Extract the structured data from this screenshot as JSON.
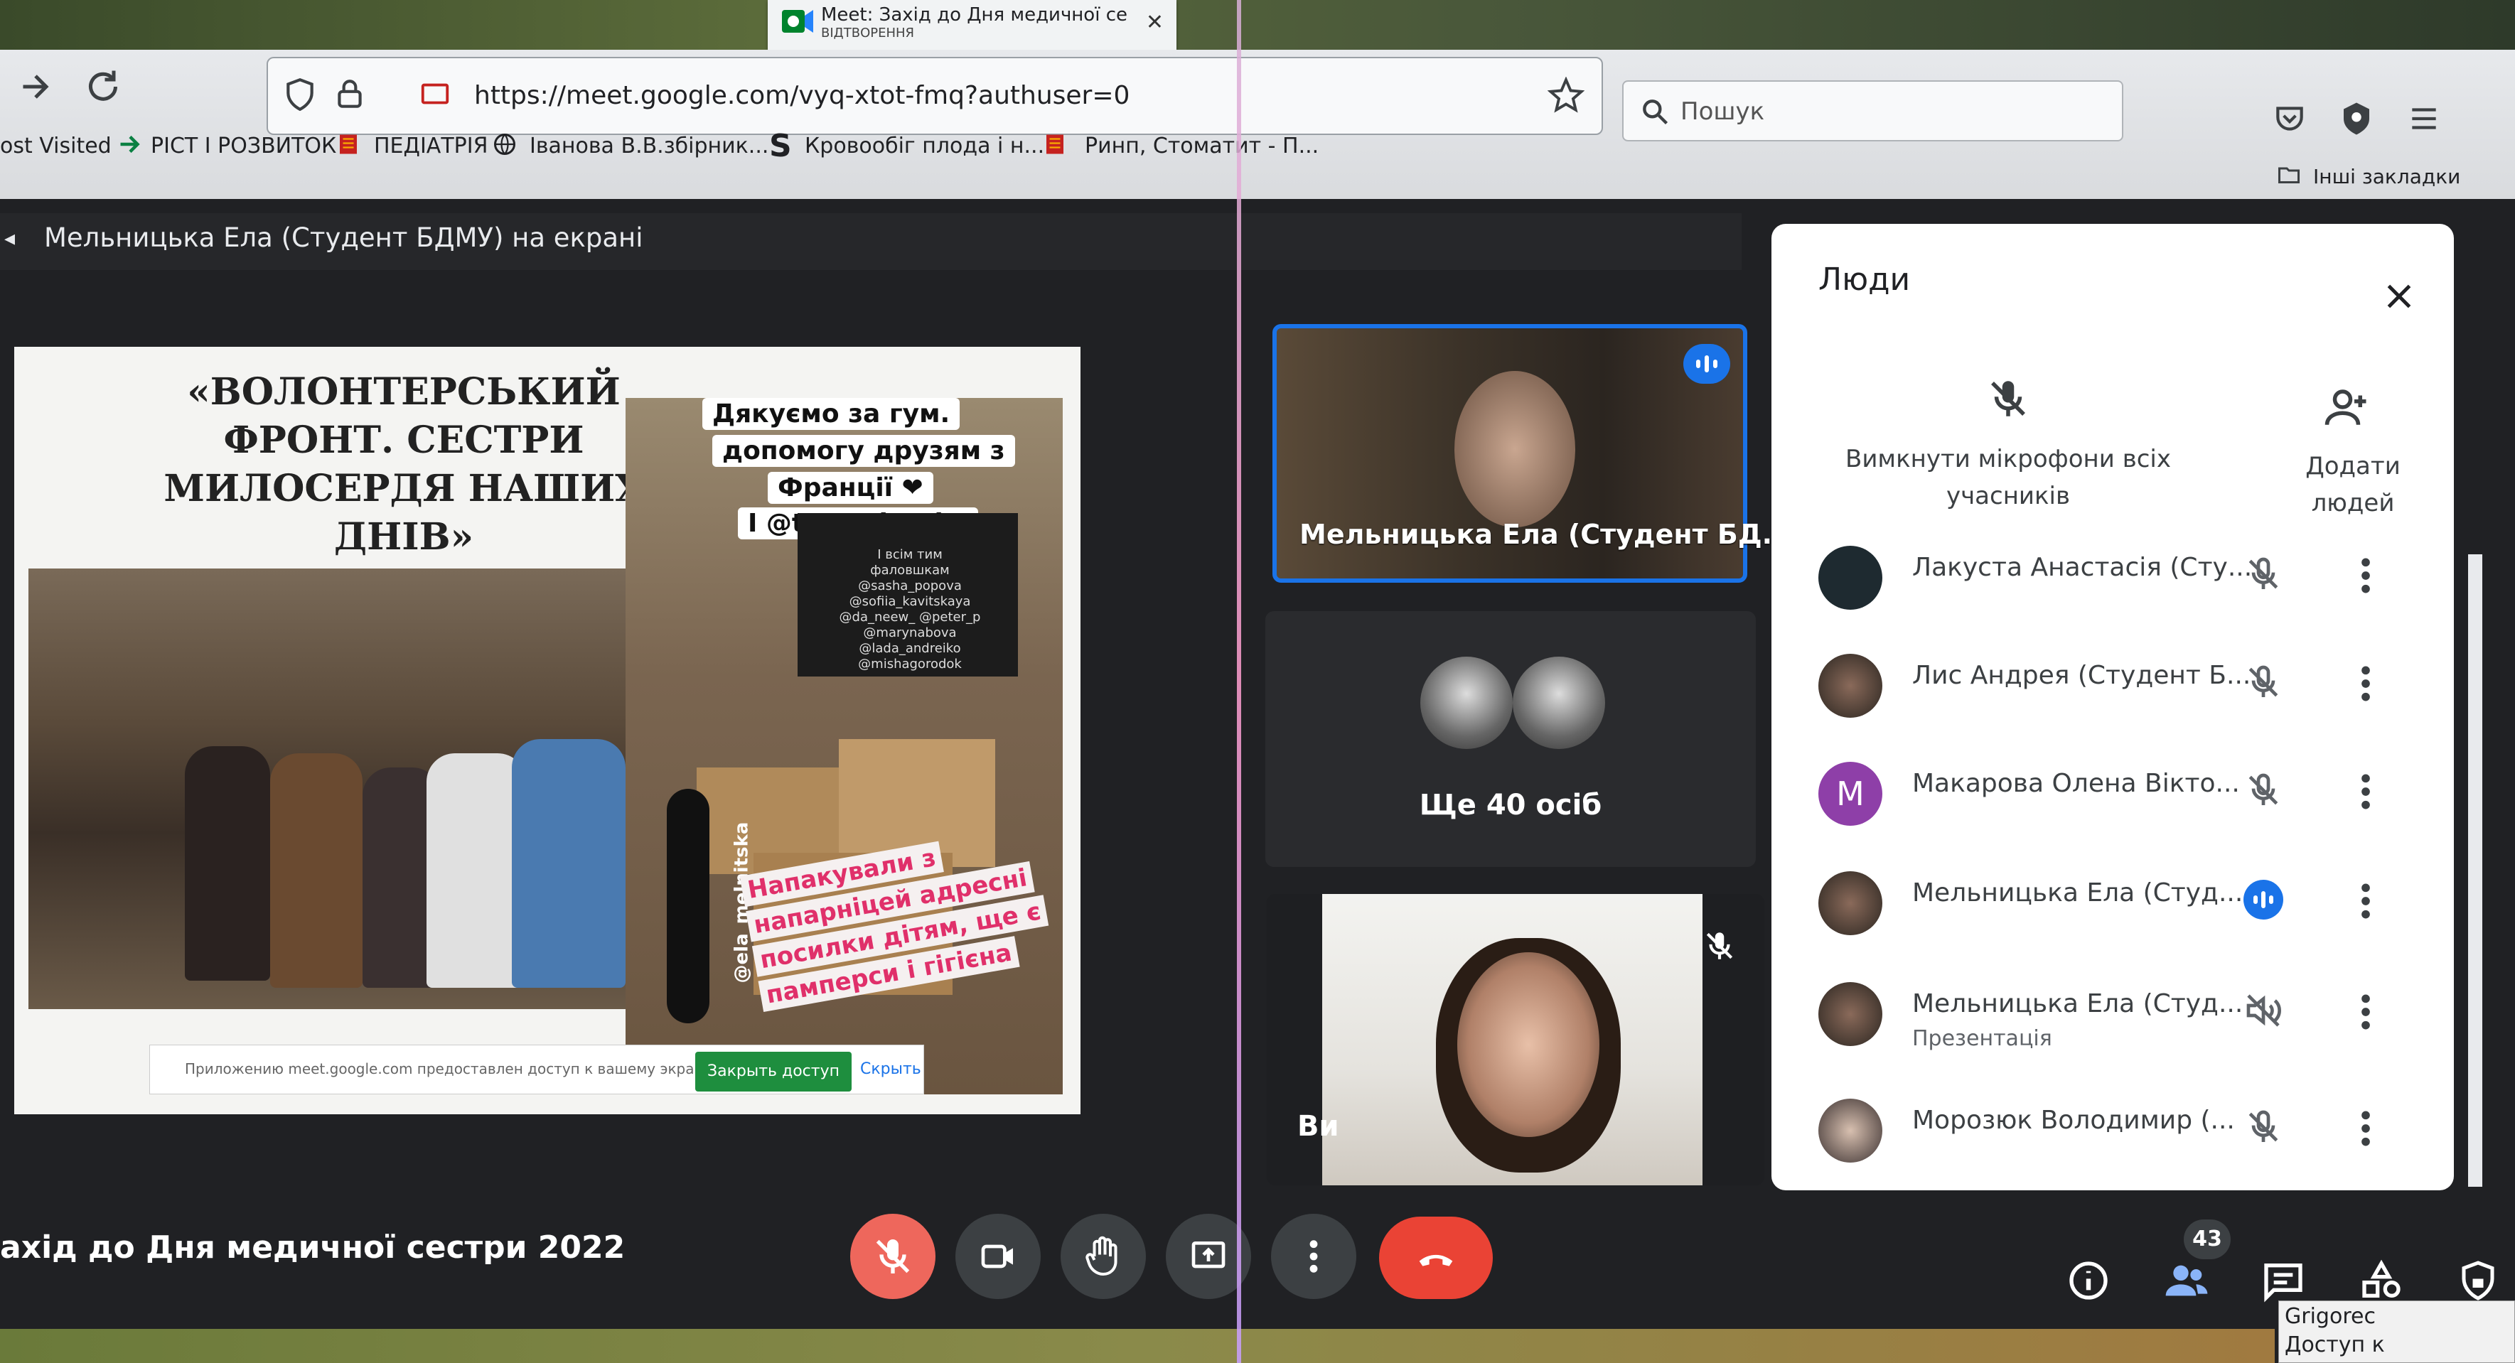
{
  "browser": {
    "tab_title": "Meet: Захід до Дня медичної се",
    "tab_subtitle": "ВІДТВОРЕННЯ",
    "url": "https://meet.google.com/vyq-xtot-fmq?authuser=0",
    "search_placeholder": "Пошук",
    "other_bookmarks": "Інші закладки",
    "bookmarks": [
      {
        "label": "ost Visited",
        "icon": "none"
      },
      {
        "label": "РІСТ І РОЗВИТОК",
        "icon": "arrow-icon"
      },
      {
        "label": "ПЕДІАТРІЯ",
        "icon": "book-icon"
      },
      {
        "label": "Іванова В.В.збірник...",
        "icon": "globe-icon"
      },
      {
        "label": "Кровообіг плода і н...",
        "icon": "s-icon"
      },
      {
        "label": "Ринп, Стоматит - П...",
        "icon": "book-icon"
      }
    ]
  },
  "meet": {
    "presenting_banner": "Мельницька Ела (Студент БДМУ) на екрані",
    "meeting_title": "ахід до Дня медичної сестри 2022",
    "participants_count": "43",
    "accent_color": "#1a73e8",
    "hangup_color": "#ea4335",
    "mic_off_color": "#ee675c"
  },
  "slide": {
    "title_lines": [
      "«ВОЛОНТЕРСЬКИЙ",
      "ФРОНТ. СЕСТРИ",
      "МИЛОСЕРДЯ НАШИХ",
      "ДНІВ»"
    ],
    "caption_lines": [
      "Дякуємо за гум.",
      "допомогу друзям з",
      "Франції ❤",
      "I @tarandreyko"
    ],
    "board_lines": [
      "I всім тим",
      "фаловшкам",
      "@sasha_popova",
      "@sofiia_kavitskaya",
      "@da_neew_ @peter_p",
      "@marynabova",
      "@lada_andreiko",
      "@mishagorodok"
    ],
    "handle": "@ela_melnitska",
    "pink_lines": [
      "Напакували з",
      "напарніцей адресні",
      "посилки дітям, ще є",
      "памперси і гігієна"
    ],
    "share_notice": "Приложению meet.google.com предоставлен доступ к вашему экрану.",
    "stop_share": "Закрыть доступ",
    "hide": "Скрыть"
  },
  "tiles": {
    "main_name": "Мельницька Ела (Студент БД...",
    "more_people": "Ще 40 осіб",
    "self_label": "Ви"
  },
  "people_panel": {
    "title": "Люди",
    "mute_all": "Вимкнути мікрофони всіх учасників",
    "add_people": "Додати людей",
    "participants": [
      {
        "name": "Лакуста Анастасія (Сту...",
        "sub": "",
        "status": "muted",
        "avatar": "dark"
      },
      {
        "name": "Лис Андрея (Студент Б...",
        "sub": "",
        "status": "muted",
        "avatar": "photo"
      },
      {
        "name": "Макарова Олена Вікто...",
        "sub": "",
        "status": "muted",
        "avatar": "letter",
        "letter": "M"
      },
      {
        "name": "Мельницька Ела (Студ...",
        "sub": "",
        "status": "speaking",
        "avatar": "photo"
      },
      {
        "name": "Мельницька Ела (Студ...",
        "sub": "Презентація",
        "status": "presenting",
        "avatar": "photo"
      },
      {
        "name": "Морозюк Володимир (...",
        "sub": "",
        "status": "muted",
        "avatar": "photo"
      }
    ]
  },
  "system": {
    "tooltip_line1": "Grigorec",
    "tooltip_line2": "Доступ к Интернету"
  }
}
